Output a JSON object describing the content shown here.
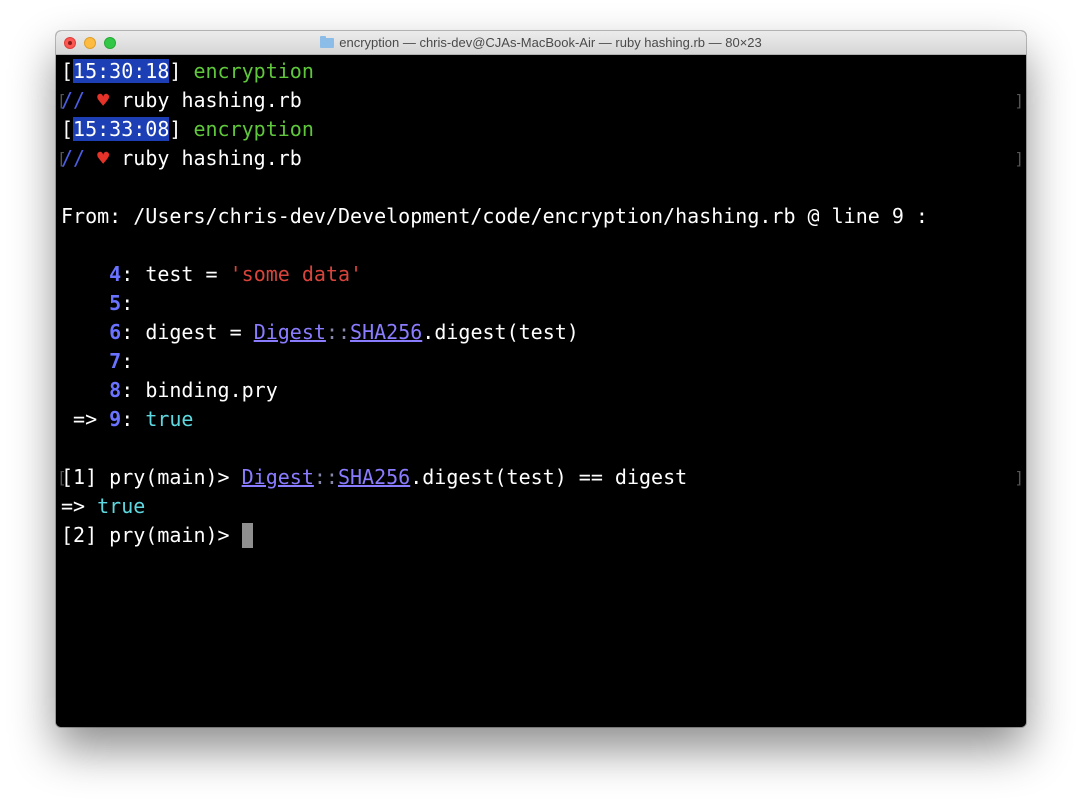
{
  "window": {
    "title": "encryption — chris-dev@CJAs-MacBook-Air — ruby hashing.rb — 80×23"
  },
  "terminal": {
    "prompt1": {
      "open": "[",
      "time": "15:30:18",
      "close": "]",
      "dir": "encryption"
    },
    "cmd1": {
      "slashes": "//",
      "heart": "♥",
      "command": "ruby hashing.rb"
    },
    "prompt2": {
      "open": "[",
      "time": "15:33:08",
      "close": "]",
      "dir": "encryption"
    },
    "cmd2": {
      "slashes": "//",
      "heart": "♥",
      "command": "ruby hashing.rb"
    },
    "from_line": "From: /Users/chris-dev/Development/code/encryption/hashing.rb @ line 9 :",
    "code": {
      "l4": {
        "num": "4",
        "sep": ": ",
        "pre": "test = ",
        "str": "'some data'"
      },
      "l5": {
        "num": "5",
        "sep": ":"
      },
      "l6": {
        "num": "6",
        "sep": ": ",
        "pre": "digest = ",
        "c1": "Digest",
        "colons": "::",
        "c2": "SHA256",
        "post": ".digest(test)"
      },
      "l7": {
        "num": "7",
        "sep": ":"
      },
      "l8": {
        "num": "8",
        "sep": ": ",
        "pre": "binding.pry"
      },
      "l9": {
        "arrow": " => ",
        "num": "9",
        "sep": ": ",
        "val": "true"
      }
    },
    "pry1": {
      "prompt": "[1] pry(main)> ",
      "c1": "Digest",
      "colons": "::",
      "c2": "SHA256",
      "post": ".digest(test) == digest"
    },
    "result": {
      "arrow": "=> ",
      "val": "true"
    },
    "pry2": {
      "prompt": "[2] pry(main)> "
    }
  },
  "colors": {
    "time_highlight": "#1c3fb5",
    "dir_green": "#5fc73c",
    "heart_red": "#e5332a",
    "string_red": "#d8443b",
    "line_number": "#6a73ff",
    "true_cyan": "#5ed8e0",
    "constant_purple": "#8a7cff",
    "cursor_gray": "#8f8f8f"
  },
  "icons": {
    "window_close": "close-button",
    "window_minimize": "minimize-button",
    "window_maximize": "maximize-button",
    "title_folder": "folder-icon",
    "heart": "heart-icon"
  }
}
